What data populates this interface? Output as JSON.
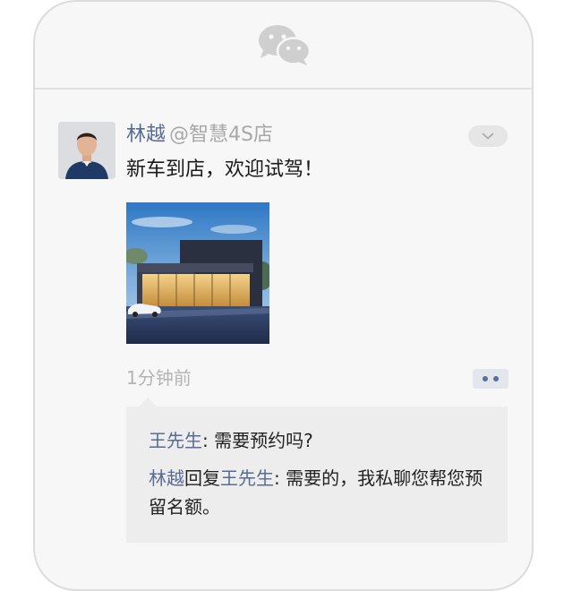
{
  "app": {
    "logo_icon": "wechat-icon"
  },
  "post": {
    "author": "林越",
    "handle": "@智慧4S店",
    "text": "新车到店，欢迎试驾！",
    "time": "1分钟前",
    "image_description": "dealership-showroom-photo",
    "menu_icon": "chevron-down-icon",
    "comment_icon": "more-dots-icon"
  },
  "comments": [
    {
      "author": "王先生",
      "separator": ": ",
      "text": "需要预约吗?"
    },
    {
      "author": "林越",
      "reply_word": "回复",
      "reply_to": "王先生",
      "separator": ": ",
      "text": "需要的，我私聊您帮您预留名额。"
    }
  ],
  "colors": {
    "link": "#576b95",
    "background": "#f7f7f7",
    "comment_bg": "#ededed",
    "timestamp": "#b4b4b4"
  }
}
